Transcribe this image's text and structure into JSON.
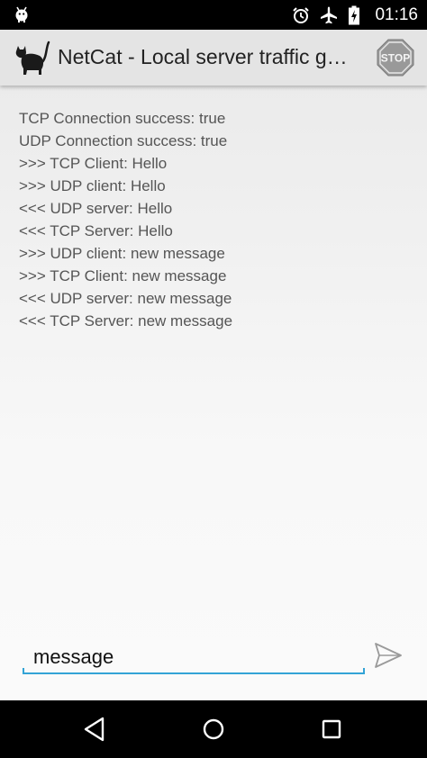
{
  "status_bar": {
    "time": "01:16",
    "left_icon": "android-debug-icon",
    "icons": [
      "alarm-icon",
      "airplane-mode-icon",
      "battery-charging-icon"
    ]
  },
  "action_bar": {
    "title": "NetCat - Local server traffic g…",
    "app_icon": "cat-icon",
    "stop_label": "STOP"
  },
  "log": {
    "lines": [
      "TCP Connection success: true",
      "UDP Connection success: true",
      ">>> TCP Client: Hello",
      ">>> UDP client: Hello",
      "<<< UDP server: Hello",
      "<<< TCP Server: Hello",
      ">>> UDP client: new message",
      ">>> TCP Client: new message",
      "<<< UDP server: new message",
      "<<< TCP Server: new message"
    ]
  },
  "composer": {
    "value": "message",
    "send_icon": "send-icon"
  },
  "nav_bar": {
    "buttons": [
      "back-icon",
      "home-icon",
      "recents-icon"
    ]
  },
  "colors": {
    "accent": "#33a3d6",
    "stop_sign": "#999999",
    "action_bar": "#e4e4e4",
    "text": "#555555"
  }
}
